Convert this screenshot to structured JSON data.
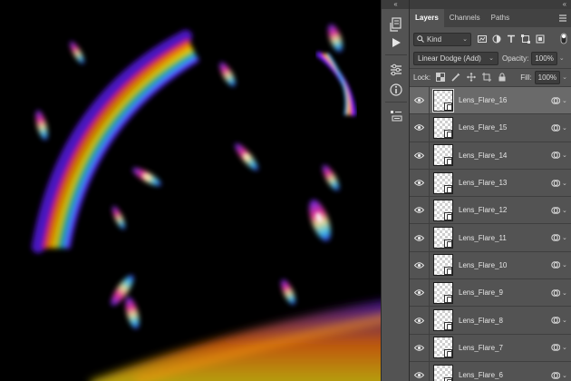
{
  "panel": {
    "tabs": [
      {
        "label": "Layers",
        "active": true
      },
      {
        "label": "Channels",
        "active": false
      },
      {
        "label": "Paths",
        "active": false
      }
    ],
    "filter_kind": "Kind",
    "blend_mode": "Linear Dodge (Add)",
    "opacity_label": "Opacity:",
    "opacity_value": "100%",
    "lock_label": "Lock:",
    "fill_label": "Fill:",
    "fill_value": "100%"
  },
  "layers": [
    {
      "name": "Lens_Flare_16",
      "selected": true
    },
    {
      "name": "Lens_Flare_15",
      "selected": false
    },
    {
      "name": "Lens_Flare_14",
      "selected": false
    },
    {
      "name": "Lens_Flare_13",
      "selected": false
    },
    {
      "name": "Lens_Flare_12",
      "selected": false
    },
    {
      "name": "Lens_Flare_11",
      "selected": false
    },
    {
      "name": "Lens_Flare_10",
      "selected": false
    },
    {
      "name": "Lens_Flare_9",
      "selected": false
    },
    {
      "name": "Lens_Flare_8",
      "selected": false
    },
    {
      "name": "Lens_Flare_7",
      "selected": false
    },
    {
      "name": "Lens_Flare_6",
      "selected": false
    }
  ],
  "colors": {
    "panel_bg": "#535353",
    "selected_row": "#6a6a6a",
    "canvas_bg": "#000000"
  }
}
